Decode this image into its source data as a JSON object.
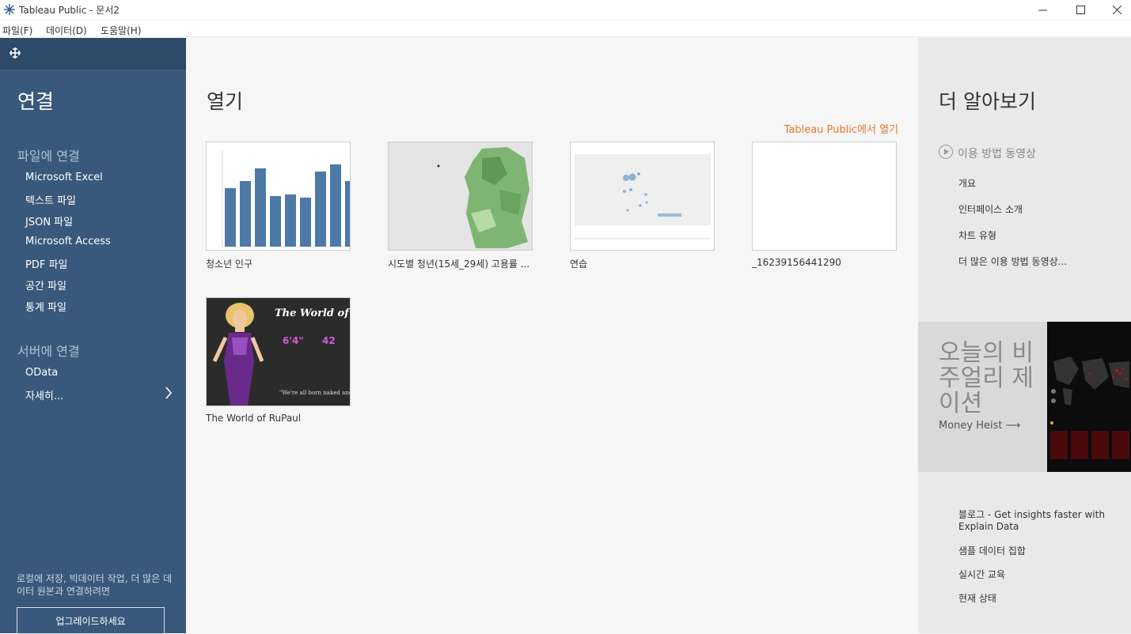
{
  "window": {
    "title": "Tableau Public - 문서2"
  },
  "menu": [
    "파일(F)",
    "데이터(D)",
    "도움말(H)"
  ],
  "connect": {
    "heading": "연결",
    "file_section": "파일에 연결",
    "file_items": [
      "Microsoft Excel",
      "텍스트 파일",
      "JSON 파일",
      "Microsoft Access",
      "PDF 파일",
      "공간 파일",
      "통계 파일"
    ],
    "server_section": "서버에 연결",
    "server_items": [
      "OData",
      "자세히..."
    ],
    "footnote": "로컬에 저장, 빅데이터 작업, 더 많은 데이터 원본과 연결하려면",
    "upgrade_button": "업그레이드하세요"
  },
  "open": {
    "heading": "열기",
    "public_link": "Tableau Public에서 열기",
    "workbooks": [
      {
        "label": "청소년 인구"
      },
      {
        "label": "시도별 청년(15세_29세) 고용률 ..."
      },
      {
        "label": "연습"
      },
      {
        "label": "_16239156441290"
      },
      {
        "label": "The World of RuPaul"
      }
    ],
    "rupaul_thumb": {
      "title": "The World of",
      "stat1": "6'4\"",
      "stat2": "42",
      "quote": "\"We're all born naked and the"
    }
  },
  "learn": {
    "heading": "더 알아보기",
    "video_title": "이용 방법 동영상",
    "videos": [
      "개요",
      "인터페이스 소개",
      "차트 유형",
      "더 많은 이용 방법 동영상..."
    ],
    "votd_title": "오늘의 비주얼리 제이션",
    "votd_link": "Money Heist ⟶",
    "links": [
      "블로그 - Get insights faster with Explain Data",
      "샘플 데이터 집합",
      "실시간 교육",
      "현재 상태"
    ]
  },
  "colors": {
    "sidebar": "#39597c",
    "accent": "#e8762b",
    "bar": "#4e79a7"
  }
}
